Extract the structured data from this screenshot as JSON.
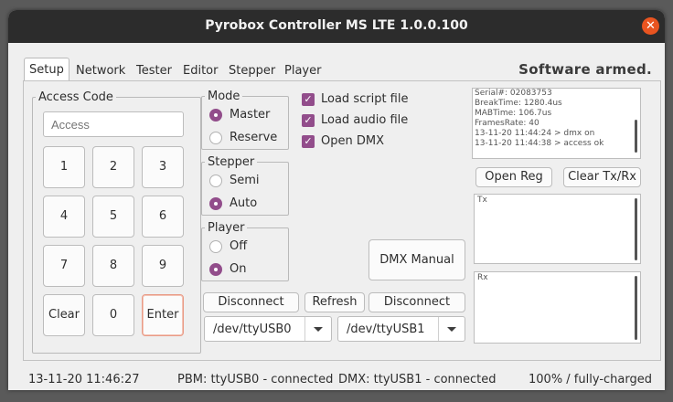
{
  "window": {
    "title": "Pyrobox Controller MS LTE 1.0.0.100",
    "close_glyph": "✕"
  },
  "tabs": [
    "Setup",
    "Network",
    "Tester",
    "Editor",
    "Stepper",
    "Player"
  ],
  "armed_status": "Software armed.",
  "access": {
    "legend": "Access Code",
    "placeholder": "Access",
    "keys": [
      "1",
      "2",
      "3",
      "4",
      "5",
      "6",
      "7",
      "8",
      "9",
      "Clear",
      "0",
      "Enter"
    ]
  },
  "mode": {
    "legend": "Mode",
    "options": [
      "Master",
      "Reserve"
    ],
    "selected": "Master"
  },
  "stepper": {
    "legend": "Stepper",
    "options": [
      "Semi",
      "Auto"
    ],
    "selected": "Auto"
  },
  "player": {
    "legend": "Player",
    "options": [
      "Off",
      "On"
    ],
    "selected": "On"
  },
  "checks": [
    "Load script file",
    "Load audio file",
    "Open DMX"
  ],
  "dmx_manual": "DMX Manual",
  "ports": {
    "left_disconnect": "Disconnect",
    "refresh": "Refresh",
    "right_disconnect": "Disconnect",
    "left_port": "/dev/ttyUSB0",
    "right_port": "/dev/ttyUSB1"
  },
  "log": [
    "Serial#: 02083753",
    "BreakTime: 1280.4us",
    "MABTime: 106.7us",
    "FramesRate: 40",
    "13-11-20 11:44:24 > dmx on",
    "13-11-20 11:44:38 > access ok"
  ],
  "log_buttons": {
    "open_reg": "Open Reg",
    "clear": "Clear Tx/Rx"
  },
  "tx_label": "Tx",
  "rx_label": "Rx",
  "statusbar": {
    "datetime": "13-11-20 11:46:27",
    "pbm": "PBM: ttyUSB0 - connected",
    "dmx": "DMX: ttyUSB1 - connected",
    "battery": "100% / fully-charged"
  },
  "colors": {
    "accent": "#924d8b",
    "close": "#e95420",
    "titlebar": "#2c2c2c"
  }
}
